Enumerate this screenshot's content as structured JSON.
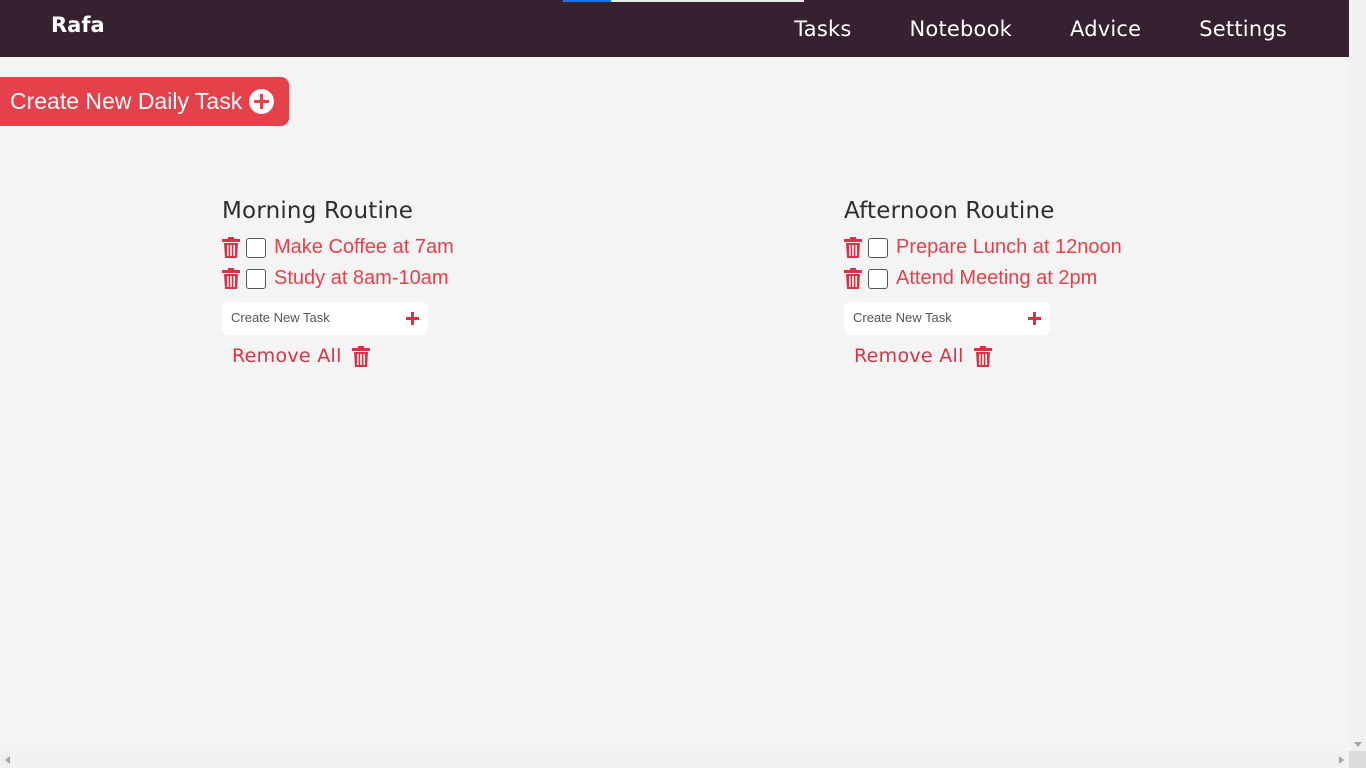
{
  "app": {
    "brand": "Rafa",
    "progress_percent": 20,
    "colors": {
      "navbar": "#35212f",
      "accent": "#e5414a",
      "icon_red": "#d63347",
      "background": "#f4f4f4"
    }
  },
  "nav": {
    "items": [
      {
        "label": "Tasks"
      },
      {
        "label": "Notebook"
      },
      {
        "label": "Advice"
      },
      {
        "label": "Settings"
      }
    ]
  },
  "create_daily": {
    "label": "Create New Daily Task",
    "icon": "plus-circle-icon"
  },
  "routines": [
    {
      "title": "Morning Routine",
      "tasks": [
        {
          "text": "Make Coffee at 7am",
          "checked": false
        },
        {
          "text": "Study at 8am-10am",
          "checked": false
        }
      ],
      "new_task_placeholder": "Create New Task",
      "remove_all_label": "Remove All"
    },
    {
      "title": "Afternoon Routine",
      "tasks": [
        {
          "text": "Prepare Lunch at 12noon",
          "checked": false
        },
        {
          "text": "Attend Meeting at 2pm",
          "checked": false
        }
      ],
      "new_task_placeholder": "Create New Task",
      "remove_all_label": "Remove All"
    }
  ],
  "icons": {
    "trash": "trash-icon",
    "add": "plus-icon"
  }
}
